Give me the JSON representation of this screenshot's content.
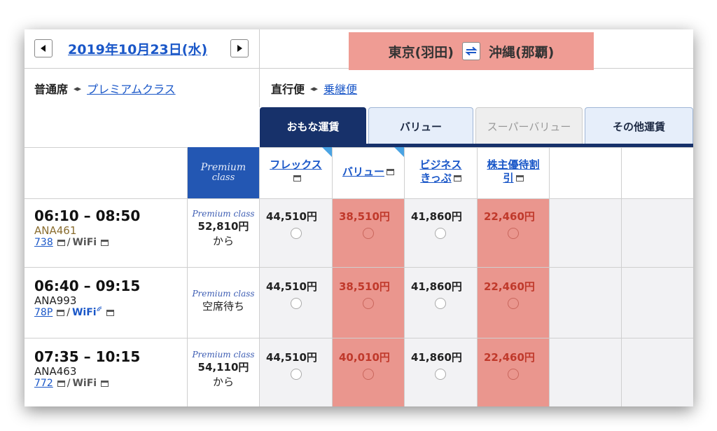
{
  "header": {
    "date": "2019年10月23日(水)",
    "origin": "東京(羽田)",
    "destination": "沖縄(那覇)"
  },
  "seat_class": {
    "current": "普通席",
    "alternate": "プレミアムクラス"
  },
  "route_type": {
    "current": "直行便",
    "alternate": "乗継便"
  },
  "tabs": [
    {
      "label": "おもな運賃",
      "state": "active"
    },
    {
      "label": "バリュー",
      "state": "normal"
    },
    {
      "label": "スーパーバリュー",
      "state": "disabled"
    },
    {
      "label": "その他運賃",
      "state": "normal"
    }
  ],
  "columns": {
    "premium": {
      "line1": "Premium",
      "line2": "class"
    },
    "fares": [
      {
        "line1": "フレックス",
        "line2": ""
      },
      {
        "line1": "バリュー",
        "line2": ""
      },
      {
        "line1": "ビジネス",
        "line2": "きっぷ"
      },
      {
        "line1": "株主優待割",
        "line2": "引"
      }
    ]
  },
  "flights": [
    {
      "time": "06:10 – 08:50",
      "number": "ANA461",
      "aircraft": "738",
      "wifi": "WiFi",
      "premium_label": "Premium class",
      "premium_price": "52,810円",
      "premium_note": "から",
      "fares": [
        "44,510円",
        "38,510円",
        "41,860円",
        "22,460円"
      ]
    },
    {
      "time": "06:40 – 09:15",
      "number": "ANA993",
      "aircraft": "78P",
      "wifi": "WiFi",
      "premium_label": "Premium class",
      "premium_price": "",
      "premium_note": "空席待ち",
      "fares": [
        "44,510円",
        "38,510円",
        "41,860円",
        "22,460円"
      ]
    },
    {
      "time": "07:35 – 10:15",
      "number": "ANA463",
      "aircraft": "772",
      "wifi": "WiFi",
      "premium_label": "Premium class",
      "premium_price": "54,110円",
      "premium_note": "から",
      "fares": [
        "44,510円",
        "40,010円",
        "41,860円",
        "22,460円"
      ]
    }
  ],
  "colors": {
    "navy": "#17316a",
    "highlight": "#ea968e",
    "link": "#1a57c8",
    "premium_blue": "#2357b3"
  }
}
